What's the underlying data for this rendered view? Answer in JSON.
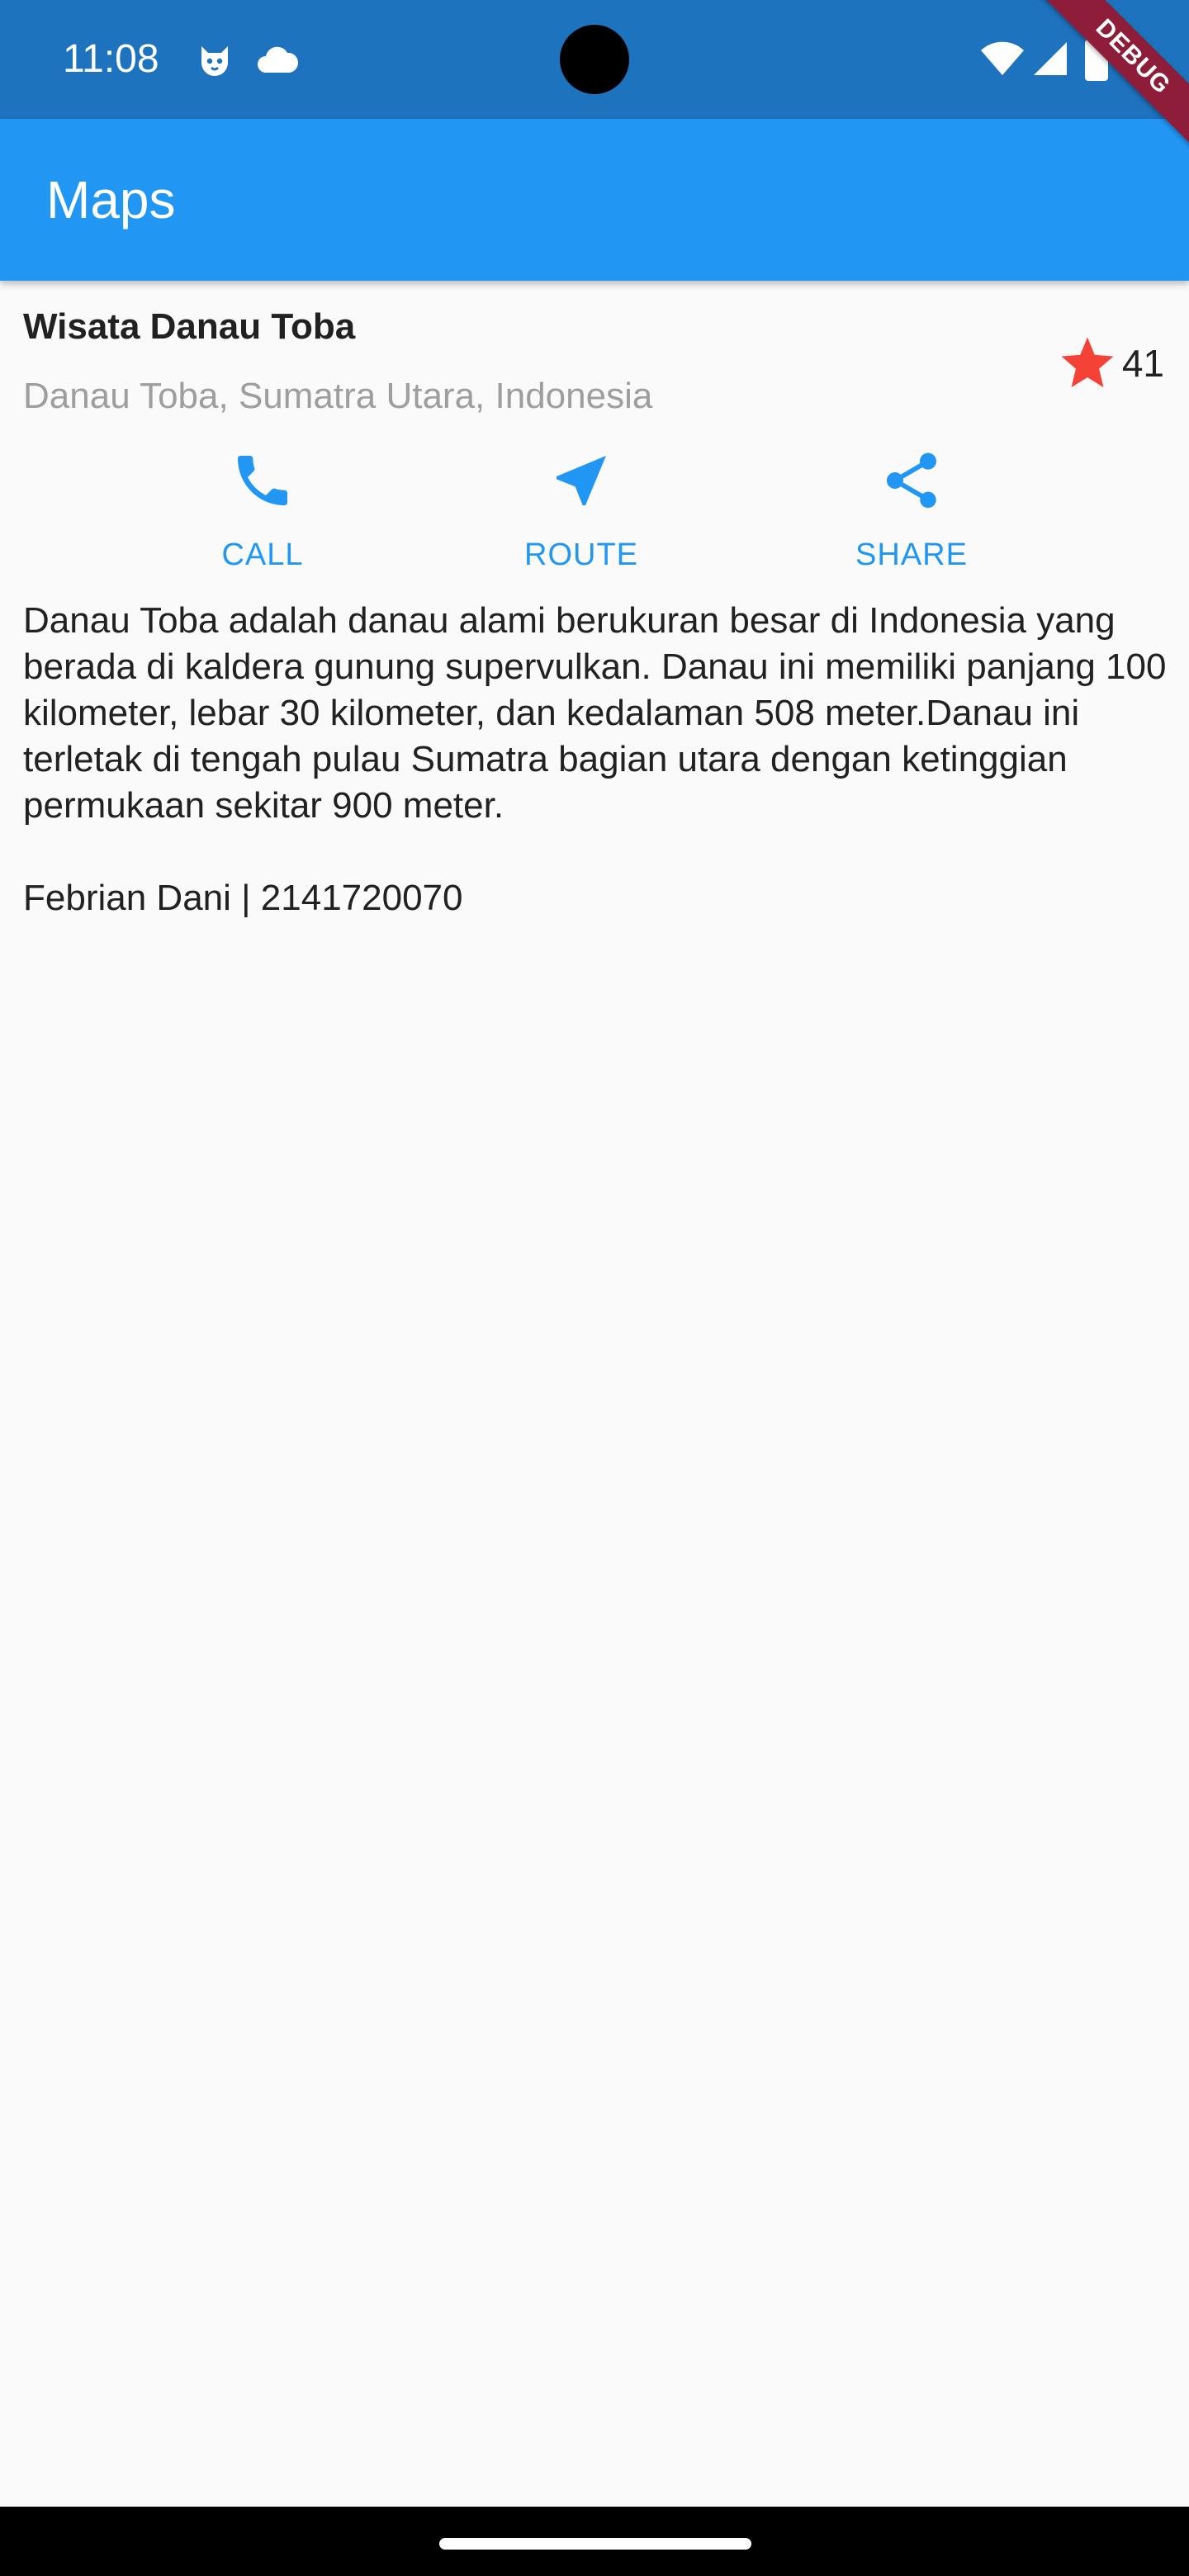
{
  "status_bar": {
    "time": "11:08",
    "left_icons": [
      "cat-face-icon",
      "cloud-icon"
    ],
    "right_icons": [
      "wifi-icon",
      "cellular-signal-icon",
      "battery-icon"
    ],
    "background_color": "#1E73BE"
  },
  "debug_banner": {
    "label": "DEBUG"
  },
  "app_bar": {
    "title": "Maps",
    "background_color": "#2196F3"
  },
  "place": {
    "title": "Wisata Danau Toba",
    "location": "Danau Toba, Sumatra Utara, Indonesia",
    "rating": {
      "icon": "star-icon",
      "color": "#F44336",
      "value": "41"
    }
  },
  "actions": [
    {
      "icon": "phone-icon",
      "label": "CALL"
    },
    {
      "icon": "navigation-arrow-icon",
      "label": "ROUTE"
    },
    {
      "icon": "share-icon",
      "label": "SHARE"
    }
  ],
  "accent_color": "#2196F3",
  "description": "Danau Toba adalah danau alami berukuran besar di Indonesia yang berada di kaldera gunung supervulkan. Danau ini memiliki panjang 100 kilometer, lebar 30 kilometer, dan kedalaman 508 meter.Danau ini terletak di tengah pulau Sumatra bagian utara dengan ketinggian permukaan sekitar 900 meter.\n\nFebrian Dani | 2141720070"
}
